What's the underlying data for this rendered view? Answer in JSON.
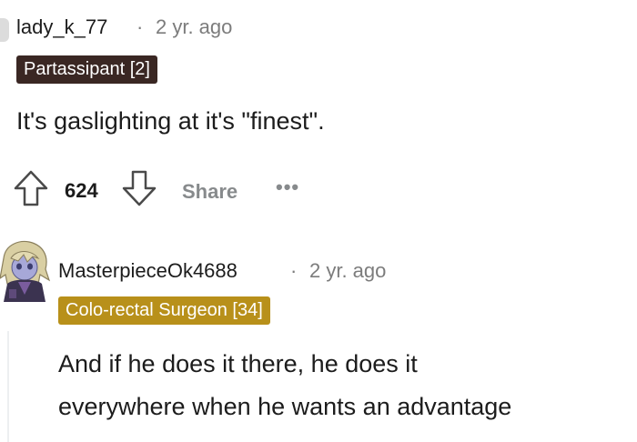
{
  "comments": [
    {
      "username": "lady_k_77",
      "separator": "·",
      "timestamp": "2 yr. ago",
      "flair": "Partassipant [2]",
      "flair_bg": "#3a2723",
      "text": "It's gaslighting at it's \"finest\".",
      "vote_count": "624",
      "share_label": "Share",
      "more_label": "•••",
      "icons": [
        "upvote-arrow-icon",
        "downvote-arrow-icon",
        "more-icon"
      ]
    },
    {
      "username": "MasterpieceOk4688",
      "separator": "·",
      "timestamp": "2 yr. ago",
      "flair": "Colo-rectal Surgeon [34]",
      "flair_bg": "#b8901a",
      "text_lines": [
        "And if he does it there, he does it",
        "everywhere when he wants an advantage"
      ],
      "avatar": "anime-character-avatar"
    }
  ]
}
